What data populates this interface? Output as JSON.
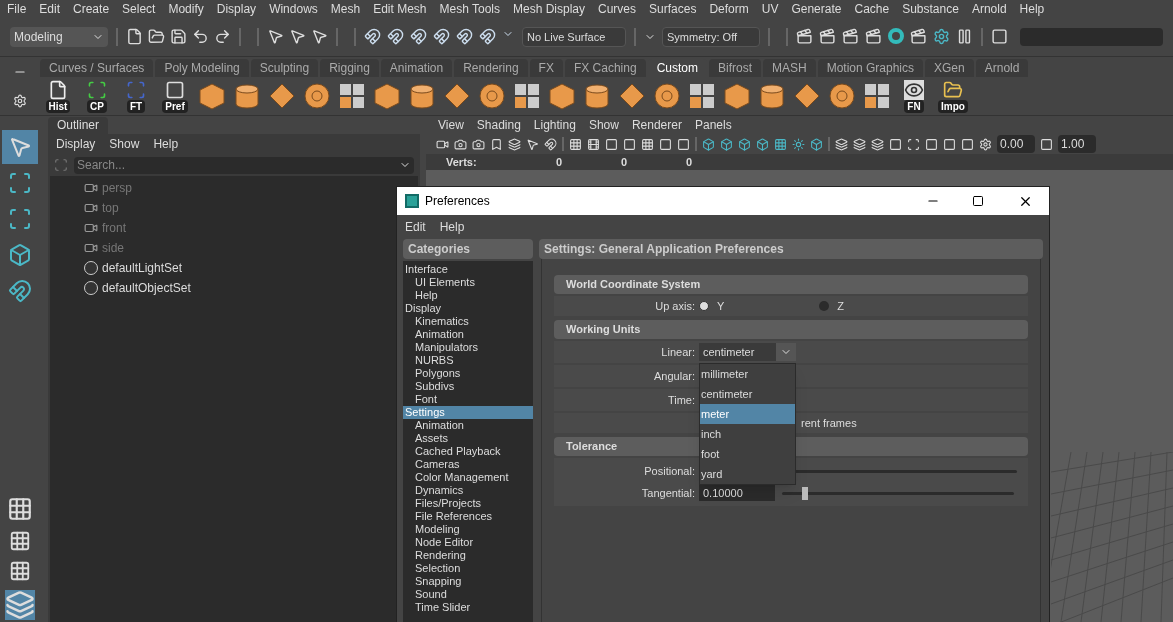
{
  "menubar": [
    "File",
    "Edit",
    "Create",
    "Select",
    "Modify",
    "Display",
    "Windows",
    "Mesh",
    "Edit Mesh",
    "Mesh Tools",
    "Mesh Display",
    "Curves",
    "Surfaces",
    "Deform",
    "UV",
    "Generate",
    "Cache",
    "Substance",
    "Arnold",
    "Help"
  ],
  "status_line": {
    "workspace": "Modeling",
    "live_surface": "No Live Surface",
    "symmetry": "Symmetry: Off"
  },
  "shelf": {
    "tabs": [
      {
        "label": "Curves / Surfaces",
        "selected": false
      },
      {
        "label": "Poly Modeling",
        "selected": false
      },
      {
        "label": "Sculpting",
        "selected": false
      },
      {
        "label": "Rigging",
        "selected": false
      },
      {
        "label": "Animation",
        "selected": false
      },
      {
        "label": "Rendering",
        "selected": false
      },
      {
        "label": "FX",
        "selected": false
      },
      {
        "label": "FX Caching",
        "selected": false
      },
      {
        "label": "Custom",
        "selected": true
      },
      {
        "label": "Bifrost",
        "selected": false
      },
      {
        "label": "MASH",
        "selected": false
      },
      {
        "label": "Motion Graphics",
        "selected": false
      },
      {
        "label": "XGen",
        "selected": false
      },
      {
        "label": "Arnold",
        "selected": false
      }
    ],
    "lead_buttons": [
      "Hist",
      "CP",
      "FT",
      "Pref"
    ],
    "tail_buttons": [
      "FN",
      "Impo"
    ]
  },
  "toolbox": [
    {
      "selected": true
    },
    {
      "selected": false
    },
    {
      "selected": false
    },
    {
      "selected": false
    },
    {
      "selected": false
    }
  ],
  "outliner": {
    "title": "Outliner",
    "menu": [
      "Display",
      "Show",
      "Help"
    ],
    "search_placeholder": "Search...",
    "items": [
      {
        "label": "persp",
        "kind": "camera",
        "dimmed": true
      },
      {
        "label": "top",
        "kind": "camera",
        "dimmed": true
      },
      {
        "label": "front",
        "kind": "camera",
        "dimmed": true
      },
      {
        "label": "side",
        "kind": "camera",
        "dimmed": true
      },
      {
        "label": "defaultLightSet",
        "kind": "set",
        "dimmed": false
      },
      {
        "label": "defaultObjectSet",
        "kind": "set",
        "dimmed": false
      }
    ]
  },
  "viewport": {
    "menu": [
      "View",
      "Shading",
      "Lighting",
      "Show",
      "Renderer",
      "Panels"
    ],
    "fields": [
      "0.00",
      "1.00"
    ],
    "stats_label": "Verts:",
    "stats_values": [
      "0",
      "0",
      "0"
    ]
  },
  "dialog": {
    "title": "Preferences",
    "menu": [
      "Edit",
      "Help"
    ],
    "categories_title": "Categories",
    "categories": [
      {
        "label": "Interface",
        "selected": false,
        "children": [
          {
            "label": "UI Elements",
            "selected": false
          },
          {
            "label": "Help",
            "selected": false
          }
        ]
      },
      {
        "label": "Display",
        "selected": false,
        "children": [
          {
            "label": "Kinematics",
            "selected": false
          },
          {
            "label": "Animation",
            "selected": false
          },
          {
            "label": "Manipulators",
            "selected": false
          },
          {
            "label": "NURBS",
            "selected": false
          },
          {
            "label": "Polygons",
            "selected": false
          },
          {
            "label": "Subdivs",
            "selected": false
          },
          {
            "label": "Font",
            "selected": false
          }
        ]
      },
      {
        "label": "Settings",
        "selected": true,
        "children": [
          {
            "label": "Animation",
            "selected": false
          },
          {
            "label": "Assets",
            "selected": false
          },
          {
            "label": "Cached Playback",
            "selected": false
          },
          {
            "label": "Cameras",
            "selected": false
          },
          {
            "label": "Color Management",
            "selected": false
          },
          {
            "label": "Dynamics",
            "selected": false
          },
          {
            "label": "Files/Projects",
            "selected": false
          },
          {
            "label": "File References",
            "selected": false
          },
          {
            "label": "Modeling",
            "selected": false
          },
          {
            "label": "Node Editor",
            "selected": false
          },
          {
            "label": "Rendering",
            "selected": false
          },
          {
            "label": "Selection",
            "selected": false
          },
          {
            "label": "Snapping",
            "selected": false
          },
          {
            "label": "Sound",
            "selected": false
          },
          {
            "label": "Time Slider",
            "selected": false
          }
        ]
      }
    ],
    "settings_title": "Settings: General Application Preferences",
    "world": {
      "title": "World Coordinate System",
      "label": "Up axis:",
      "options": [
        {
          "label": "Y",
          "selected": true
        },
        {
          "label": "Z",
          "selected": false
        }
      ]
    },
    "units": {
      "title": "Working Units",
      "linear_label": "Linear:",
      "linear_value": "centimeter",
      "angular_label": "Angular:",
      "time_label": "Time:",
      "partial_text": "rent frames",
      "options": [
        {
          "label": "millimeter",
          "selected": false
        },
        {
          "label": "centimeter",
          "selected": false
        },
        {
          "label": "meter",
          "selected": true
        },
        {
          "label": "inch",
          "selected": false
        },
        {
          "label": "foot",
          "selected": false
        },
        {
          "label": "yard",
          "selected": false
        }
      ]
    },
    "tolerance": {
      "title": "Tolerance",
      "positional_label": "Positional:",
      "tangential": {
        "label": "Tangential:",
        "value": "0.10000",
        "level": 0.11
      }
    }
  }
}
